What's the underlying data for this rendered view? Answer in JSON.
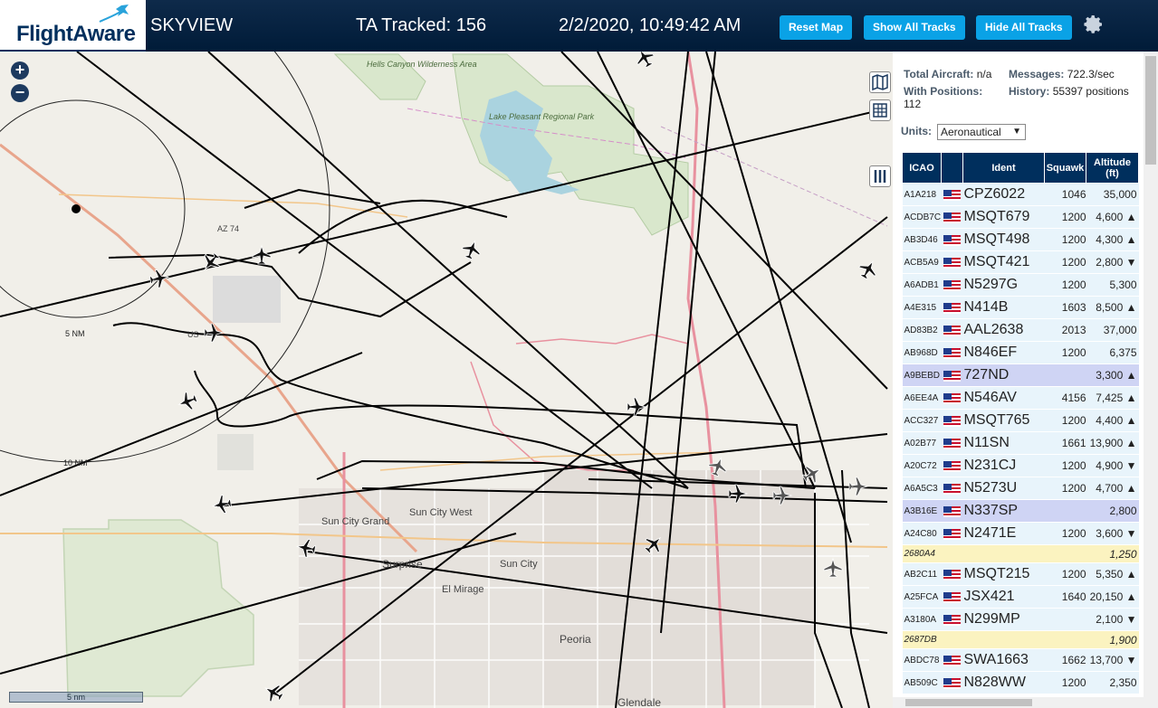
{
  "header": {
    "logo": "FlightAware",
    "app_name": "SKYVIEW",
    "tracked": "TA Tracked: 156",
    "datetime": "2/2/2020, 10:49:42 AM",
    "btn_reset": "Reset Map",
    "btn_show": "Show All Tracks",
    "btn_hide": "Hide All Tracks",
    "gear_icon": "gear-icon"
  },
  "map": {
    "zoom_in": "+",
    "zoom_out": "−",
    "scale_label": "5 nm",
    "labels": {
      "hells_canyon": "Hells Canyon Wilderness Area",
      "lake_pleasant": "Lake Pleasant Regional Park",
      "az74": "AZ 74",
      "us60": "US",
      "nm5": "5 NM",
      "nm10": "10 NM",
      "sun_city_grand": "Sun City Grand",
      "sun_city_west": "Sun City West",
      "surprise": "Surprise",
      "sun_city": "Sun City",
      "el_mirage": "El Mirage",
      "peoria": "Peoria",
      "glendale": "Glendale"
    }
  },
  "stats": {
    "total_aircraft_label": "Total Aircraft:",
    "total_aircraft_value": "n/a",
    "with_positions_label": "With Positions:",
    "with_positions_value": "112",
    "messages_label": "Messages:",
    "messages_value": "722.3/sec",
    "history_label": "History:",
    "history_value": "55397 positions"
  },
  "units": {
    "label": "Units:",
    "selected": "Aeronautical"
  },
  "table": {
    "headers": [
      "ICAO",
      "",
      "Ident",
      "Squawk",
      "Altitude (ft)"
    ],
    "rows": [
      {
        "icao": "A1A218",
        "ident": "CPZ6022",
        "squawk": "1046",
        "alt": "35,000",
        "flag": true,
        "state": ""
      },
      {
        "icao": "ACDB7C",
        "ident": "MSQT679",
        "squawk": "1200",
        "alt": "4,600 ▲",
        "flag": true,
        "state": ""
      },
      {
        "icao": "AB3D46",
        "ident": "MSQT498",
        "squawk": "1200",
        "alt": "4,300 ▲",
        "flag": true,
        "state": ""
      },
      {
        "icao": "ACB5A9",
        "ident": "MSQT421",
        "squawk": "1200",
        "alt": "2,800 ▼",
        "flag": true,
        "state": ""
      },
      {
        "icao": "A6ADB1",
        "ident": "N5297G",
        "squawk": "1200",
        "alt": "5,300",
        "flag": true,
        "state": ""
      },
      {
        "icao": "A4E315",
        "ident": "N414B",
        "squawk": "1603",
        "alt": "8,500 ▲",
        "flag": true,
        "state": ""
      },
      {
        "icao": "AD83B2",
        "ident": "AAL2638",
        "squawk": "2013",
        "alt": "37,000",
        "flag": true,
        "state": ""
      },
      {
        "icao": "AB968D",
        "ident": "N846EF",
        "squawk": "1200",
        "alt": "6,375",
        "flag": true,
        "state": ""
      },
      {
        "icao": "A9BEBD",
        "ident": "727ND",
        "squawk": "",
        "alt": "3,300 ▲",
        "flag": true,
        "state": "sel"
      },
      {
        "icao": "A6EE4A",
        "ident": "N546AV",
        "squawk": "4156",
        "alt": "7,425 ▲",
        "flag": true,
        "state": ""
      },
      {
        "icao": "ACC327",
        "ident": "MSQT765",
        "squawk": "1200",
        "alt": "4,400 ▲",
        "flag": true,
        "state": ""
      },
      {
        "icao": "A02B77",
        "ident": "N11SN",
        "squawk": "1661",
        "alt": "13,900 ▲",
        "flag": true,
        "state": ""
      },
      {
        "icao": "A20C72",
        "ident": "N231CJ",
        "squawk": "1200",
        "alt": "4,900 ▼",
        "flag": true,
        "state": ""
      },
      {
        "icao": "A6A5C3",
        "ident": "N5273U",
        "squawk": "1200",
        "alt": "4,700 ▲",
        "flag": true,
        "state": ""
      },
      {
        "icao": "A3B16E",
        "ident": "N337SP",
        "squawk": "",
        "alt": "2,800",
        "flag": true,
        "state": "sel"
      },
      {
        "icao": "A24C80",
        "ident": "N2471E",
        "squawk": "1200",
        "alt": "3,600 ▼",
        "flag": true,
        "state": ""
      },
      {
        "icao": "2680A4",
        "ident": "",
        "squawk": "",
        "alt": "1,250",
        "flag": false,
        "state": "nopos"
      },
      {
        "icao": "AB2C11",
        "ident": "MSQT215",
        "squawk": "1200",
        "alt": "5,350 ▲",
        "flag": true,
        "state": ""
      },
      {
        "icao": "A25FCA",
        "ident": "JSX421",
        "squawk": "1640",
        "alt": "20,150 ▲",
        "flag": true,
        "state": ""
      },
      {
        "icao": "A3180A",
        "ident": "N299MP",
        "squawk": "",
        "alt": "2,100 ▼",
        "flag": true,
        "state": ""
      },
      {
        "icao": "2687DB",
        "ident": "",
        "squawk": "",
        "alt": "1,900",
        "flag": false,
        "state": "nopos"
      },
      {
        "icao": "ABDC78",
        "ident": "SWA1663",
        "squawk": "1662",
        "alt": "13,700 ▼",
        "flag": true,
        "state": ""
      },
      {
        "icao": "AB509C",
        "ident": "N828WW",
        "squawk": "1200",
        "alt": "2,350",
        "flag": true,
        "state": ""
      }
    ]
  }
}
